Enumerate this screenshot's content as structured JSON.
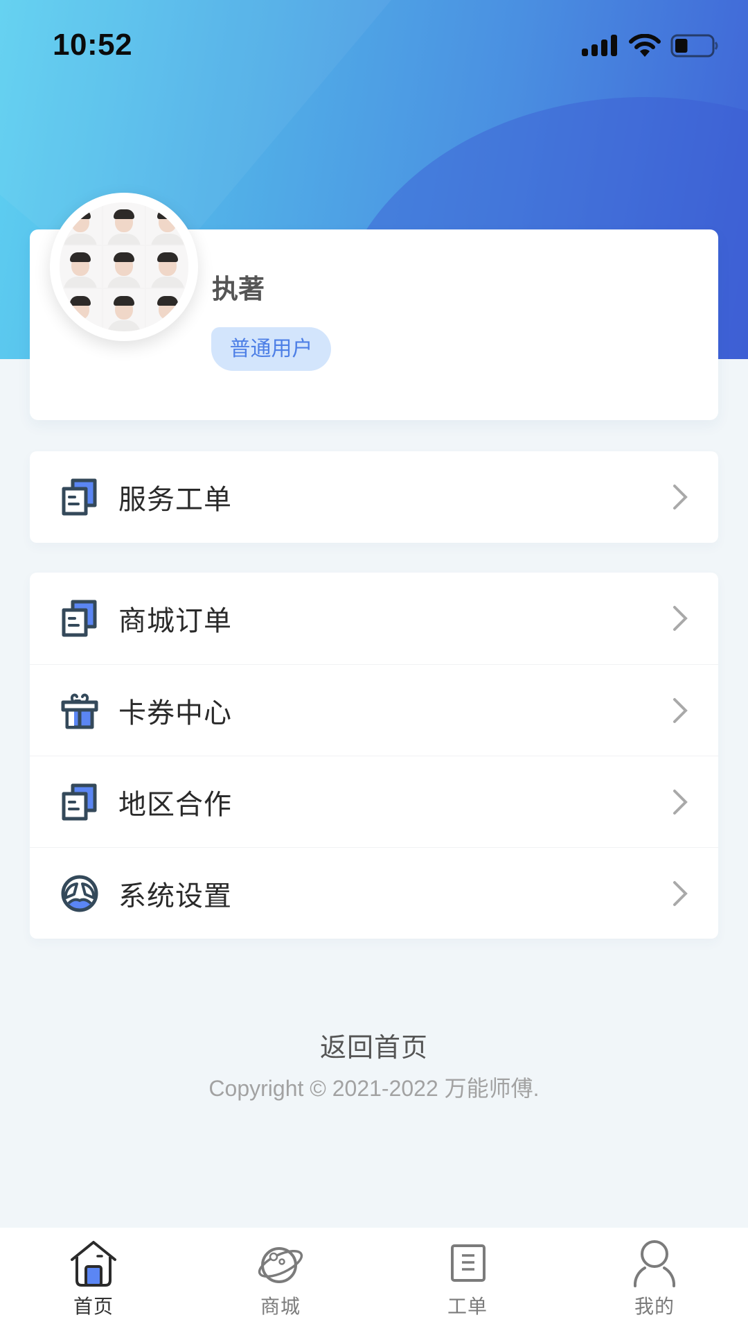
{
  "status_bar": {
    "time": "10:52",
    "battery_level_percent": 35
  },
  "profile": {
    "name": "执著",
    "badge": "普通用户",
    "avatar": "avatar-photo-grid"
  },
  "menu_groups": [
    {
      "items": [
        {
          "label": "服务工单",
          "icon": "document-stack-icon"
        }
      ]
    },
    {
      "items": [
        {
          "label": "商城订单",
          "icon": "document-stack-icon"
        },
        {
          "label": "卡券中心",
          "icon": "gift-icon"
        },
        {
          "label": "地区合作",
          "icon": "document-stack-icon"
        },
        {
          "label": "系统设置",
          "icon": "steering-wheel-icon"
        }
      ]
    }
  ],
  "footer": {
    "back_home": "返回首页",
    "copyright": "Copyright © 2021-2022 万能师傅."
  },
  "tabbar": {
    "active": "首页",
    "tabs": [
      {
        "label": "首页",
        "icon": "home-icon"
      },
      {
        "label": "商城",
        "icon": "planet-icon"
      },
      {
        "label": "工单",
        "icon": "list-document-icon"
      },
      {
        "label": "我的",
        "icon": "user-icon"
      }
    ]
  },
  "colors": {
    "accent_blue": "#5b86f4",
    "icon_dark": "#34495a",
    "badge_bg": "#d3e5fc",
    "badge_text": "#4d7fe6",
    "page_bg": "#f1f6f9",
    "header_gradient_start": "#5ed0f1",
    "header_gradient_end": "#3f62d6"
  }
}
